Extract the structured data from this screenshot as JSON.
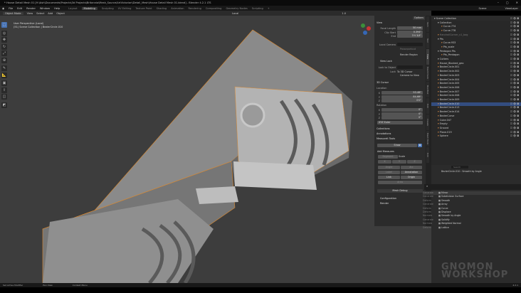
{
  "title": "* House Detail Mesh 01 [H:\\Ash\\Documents\\Projects\\3d Projects\\Britannia\\Mesh_Source\\ArtVictorian\\Detail_Mesh\\House Detail Mesh 01.blend] - Blender 4.2.1 LTS",
  "window_controls": [
    "–",
    "▢",
    "✕"
  ],
  "menu": {
    "items": [
      "File",
      "Edit",
      "Render",
      "Window",
      "Help"
    ],
    "workspaces": [
      "Layout",
      "Modeling",
      "Sculpting",
      "UV Editing",
      "Texture Paint",
      "Shading",
      "Animation",
      "Rendering",
      "Compositing",
      "Geometry Nodes",
      "Scripting",
      "+"
    ],
    "active_workspace": "Modeling",
    "scene": "Scene",
    "view_layer": "ViewLayer"
  },
  "header": {
    "mode": "Object Mode",
    "items": [
      "View",
      "Select",
      "Add",
      "Object"
    ],
    "transform": "Local",
    "overlay_value": "1.0",
    "options": "Options"
  },
  "viewport": {
    "perspective": "User Perspective (Local)",
    "collection_path": "(51) Scene Collection | BezierCircle.010"
  },
  "tools": [
    "select-box",
    "cursor",
    "move",
    "rotate",
    "scale",
    "transform",
    "annotate",
    "measure",
    "add-cube",
    "extrude",
    "inset",
    "bevel"
  ],
  "npanel": {
    "tabs": [
      "Item",
      "Tool",
      "View",
      "MeshCheck",
      "BoolTool",
      "Edit",
      "Create",
      "Mesh Tools",
      "Edit"
    ],
    "view": {
      "title": "View",
      "focal_length_label": "Focal Length",
      "focal_length": "50 mm",
      "clip_start_label": "Clip Start",
      "clip_start": "0.394\"",
      "clip_end_label": "End",
      "clip_end": "3'4 3/4\"",
      "local_camera_label": "Local Camera",
      "passepartout": "Passepartout",
      "render_region": "Render Region"
    },
    "view_lock": {
      "title": "View Lock",
      "lock_to_object_label": "Lock to Object",
      "lock_label": "Lock",
      "to_3d_cursor": "To 3D Cursor",
      "camera_to_view": "Camera to View"
    },
    "cursor": {
      "title": "3D Cursor",
      "location_label": "Location",
      "x": "93.4ft\"",
      "y": "84.6ft\"",
      "z": "0'0\"",
      "rotation_label": "Rotation",
      "rx": "0°",
      "ry": "0°",
      "rz": "0°",
      "mode": "XYZ Euler"
    },
    "sections": [
      "Collections",
      "Annotations",
      "Measureit Tools"
    ],
    "measure": {
      "show": "Show",
      "add_measures": "Add Measures",
      "segment": "Segment",
      "scale_label": "Scale",
      "x": "X",
      "y": "Y",
      "z": "Z",
      "angle": "Angle",
      "arc": "Arc",
      "label": "Label",
      "annotation": "Annotation",
      "link": "Link",
      "origin": "Origin",
      "area": "Area",
      "mesh_debug": "Mesh Debug",
      "configuration": "Configuration",
      "render": "Render"
    }
  },
  "outliner": {
    "rows": [
      {
        "name": "Scene Collection",
        "indent": 0
      },
      {
        "name": "Collection",
        "indent": 1
      },
      {
        "name": "Curve.774",
        "indent": 2
      },
      {
        "name": "Curve.778",
        "indent": 2
      },
      {
        "name": "HandrailCorner_v1_bag",
        "indent": 1,
        "dim": true
      },
      {
        "name": "Pts",
        "indent": 1
      },
      {
        "name": "Curve.933",
        "indent": 2
      },
      {
        "name": "Pts_scale",
        "indent": 2
      },
      {
        "name": "Pentagon Pts",
        "indent": 1
      },
      {
        "name": "Pts_Pentagon",
        "indent": 2
      },
      {
        "name": "Cutters",
        "indent": 1
      },
      {
        "name": "House_Blocked_geo",
        "indent": 1
      },
      {
        "name": "BezierCircle.001",
        "indent": 1
      },
      {
        "name": "BezierCircle.002",
        "indent": 1
      },
      {
        "name": "BezierCircle.003",
        "indent": 1
      },
      {
        "name": "BezierCircle.004",
        "indent": 1
      },
      {
        "name": "BezierCircle.005",
        "indent": 1
      },
      {
        "name": "BezierCircle.006",
        "indent": 1
      },
      {
        "name": "BezierCircle.007",
        "indent": 1
      },
      {
        "name": "BezierCircle.008",
        "indent": 1
      },
      {
        "name": "BezierCircle.009",
        "indent": 1
      },
      {
        "name": "BezierCircle.010",
        "indent": 1,
        "selected": true
      },
      {
        "name": "BezierCircle.013",
        "indent": 1
      },
      {
        "name": "BezierCircle.014",
        "indent": 1
      },
      {
        "name": "BezierCurve",
        "indent": 1
      },
      {
        "name": "Cube.047",
        "indent": 1
      },
      {
        "name": "Empty",
        "indent": 1
      },
      {
        "name": "Ground",
        "indent": 1
      },
      {
        "name": "Plane.019",
        "indent": 1
      },
      {
        "name": "Sphere",
        "indent": 1
      }
    ]
  },
  "properties": {
    "search_placeholder": "Search",
    "object": "BezierCircle.010",
    "modifier": "Smooth by Angle",
    "modifiers": [
      {
        "cat": "Generate",
        "name": "Mirror"
      },
      {
        "cat": "Generate",
        "name": "Subdivision Surface"
      },
      {
        "cat": "Deform",
        "name": "Smooth"
      },
      {
        "cat": "Generate",
        "name": "Array"
      },
      {
        "cat": "Deform",
        "name": "Curve"
      },
      {
        "cat": "Deform",
        "name": "Displace"
      },
      {
        "cat": "Normals",
        "name": "Smooth by Angle"
      },
      {
        "cat": "Generate",
        "name": "Solidify"
      },
      {
        "cat": "Normals",
        "name": "Weighted Normal"
      },
      {
        "cat": "Deform",
        "name": "Lattice"
      }
    ]
  },
  "status": {
    "items": [
      "Set Active Modifier",
      "Pan View",
      "Context Menu"
    ],
    "version": "4.2.1"
  },
  "logo": "THE GNOMON WORKSHOP",
  "colors": {
    "accent": "#4772b3",
    "selection": "#334d80",
    "active_edge": "#e08a2c",
    "viewport_bg": "#3d3d3d"
  }
}
